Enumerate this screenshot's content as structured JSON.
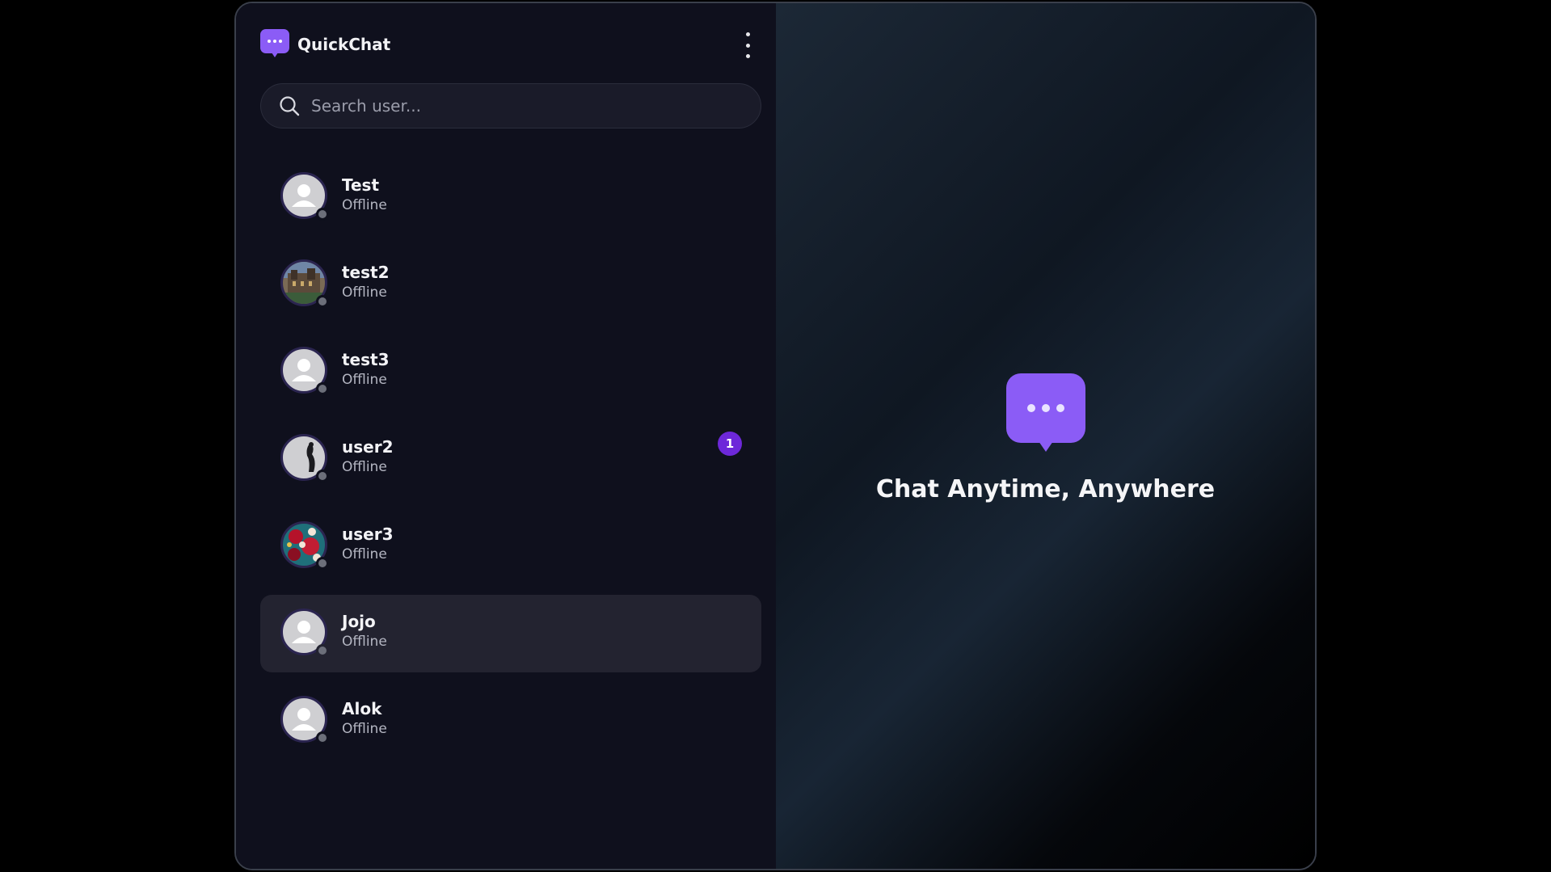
{
  "app": {
    "name": "QuickChat",
    "accent_color": "#8b5cf6",
    "menu_icon": "kebab-menu-icon"
  },
  "search": {
    "placeholder": "Search user...",
    "value": "",
    "icon": "search-icon"
  },
  "users": [
    {
      "name": "Test",
      "status": "Offline",
      "avatar": "default-avatar",
      "unread": null,
      "active": false
    },
    {
      "name": "test2",
      "status": "Offline",
      "avatar": "photo-avatar-building",
      "unread": null,
      "active": false
    },
    {
      "name": "test3",
      "status": "Offline",
      "avatar": "default-avatar",
      "unread": null,
      "active": false
    },
    {
      "name": "user2",
      "status": "Offline",
      "avatar": "photo-avatar-silhouette",
      "unread": "1",
      "active": false
    },
    {
      "name": "user3",
      "status": "Offline",
      "avatar": "photo-avatar-floral",
      "unread": null,
      "active": false
    },
    {
      "name": "Jojo",
      "status": "Offline",
      "avatar": "default-avatar",
      "unread": null,
      "active": true
    },
    {
      "name": "Alok",
      "status": "Offline",
      "avatar": "default-avatar",
      "unread": null,
      "active": false
    }
  ],
  "welcome": {
    "title": "Chat Anytime, Anywhere",
    "icon": "chat-bubble-icon"
  }
}
